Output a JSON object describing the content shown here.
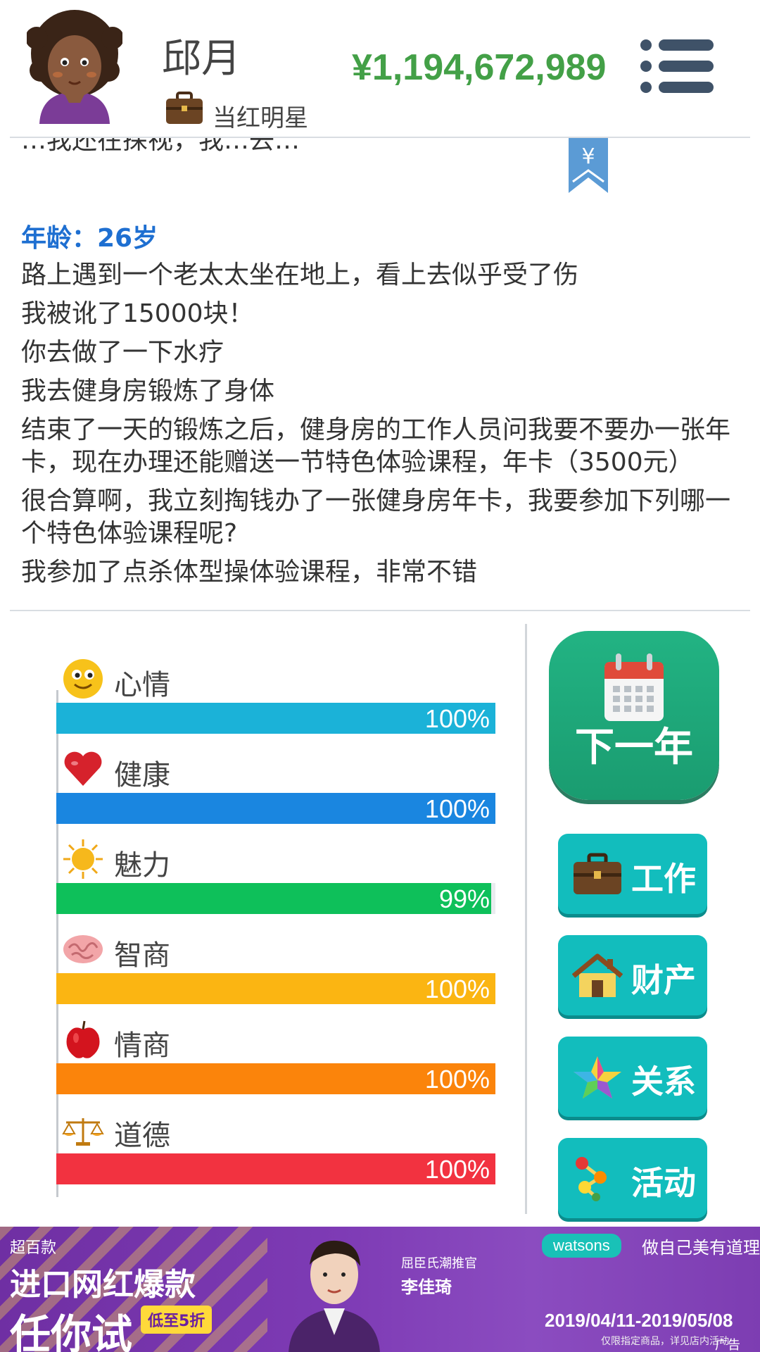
{
  "header": {
    "name": "邱月",
    "job_title": "当红明星",
    "money": "¥1,194,672,989"
  },
  "log": {
    "partial_top": "…我还在探视，我…去…",
    "bookmark_symbol": "¥",
    "age_label": "年龄：26岁",
    "entries": [
      "路上遇到一个老太太坐在地上，看上去似乎受了伤",
      "我被讹了15000块！",
      "你去做了一下水疗",
      "我去健身房锻炼了身体",
      "结束了一天的锻炼之后，健身房的工作人员问我要不要办一张年卡，现在办理还能赠送一节特色体验课程，年卡（3500元）",
      "很合算啊，我立刻掏钱办了一张健身房年卡，我要参加下列哪一个特色体验课程呢?",
      "我参加了点杀体型操体验课程，非常不错"
    ]
  },
  "stats": [
    {
      "label": "心情",
      "pct": "100%",
      "value": 100,
      "color": "#1bb2d8",
      "icon": "smiley-icon"
    },
    {
      "label": "健康",
      "pct": "100%",
      "value": 100,
      "color": "#1a86e0",
      "icon": "heart-icon"
    },
    {
      "label": "魅力",
      "pct": "99%",
      "value": 99,
      "color": "#0ec05a",
      "icon": "sun-icon"
    },
    {
      "label": "智商",
      "pct": "100%",
      "value": 100,
      "color": "#fbb512",
      "icon": "brain-icon"
    },
    {
      "label": "情商",
      "pct": "100%",
      "value": 100,
      "color": "#fb840b",
      "icon": "apple-icon"
    },
    {
      "label": "道德",
      "pct": "100%",
      "value": 100,
      "color": "#f23240",
      "icon": "scales-icon"
    }
  ],
  "buttons": {
    "next_year": "下一年",
    "work": "工作",
    "assets": "财产",
    "relations": "关系",
    "activities": "活动"
  },
  "ad": {
    "sale_top": "超百款",
    "sale_main": "进口网红爆款",
    "sale_try": "任你试",
    "discount": "低至5折",
    "recommend": "屈臣氏潮推官",
    "celebrity": "李佳琦",
    "brand": "watsons",
    "slogan": "做自己美有道理",
    "dates": "2019/04/11-2019/05/08",
    "fine_print": "仅限指定商品，详见店内活动",
    "ad_label": "广告"
  }
}
